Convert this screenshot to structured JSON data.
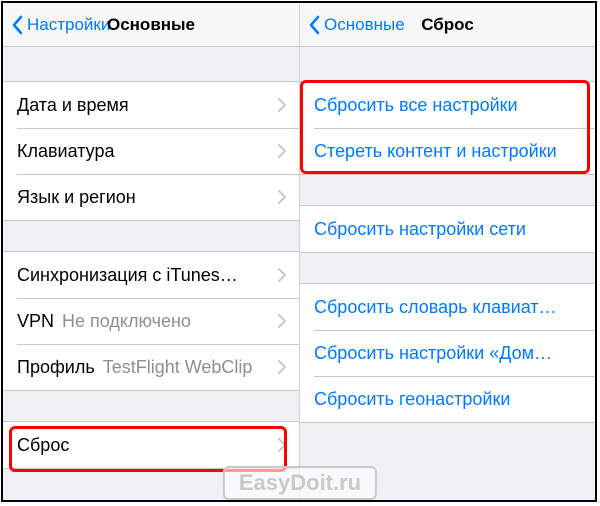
{
  "left": {
    "back": "Настройки",
    "title": "Основные",
    "group1": [
      {
        "label": "Дата и время"
      },
      {
        "label": "Клавиатура"
      },
      {
        "label": "Язык и регион"
      }
    ],
    "group2": [
      {
        "label": "Синхронизация с iTunes…"
      },
      {
        "label": "VPN",
        "value": "Не подключено"
      },
      {
        "label": "Профиль",
        "value": "TestFlight WebClip"
      }
    ],
    "group3": [
      {
        "label": "Сброс"
      }
    ]
  },
  "right": {
    "back": "Основные",
    "title": "Сброс",
    "group1": [
      "Сбросить все настройки",
      "Стереть контент и настройки"
    ],
    "group2": [
      "Сбросить настройки сети"
    ],
    "group3": [
      "Сбросить словарь клавиат…",
      "Сбросить настройки «Дом…",
      "Сбросить геонастройки"
    ]
  },
  "watermark": "EasyDoit.ru"
}
